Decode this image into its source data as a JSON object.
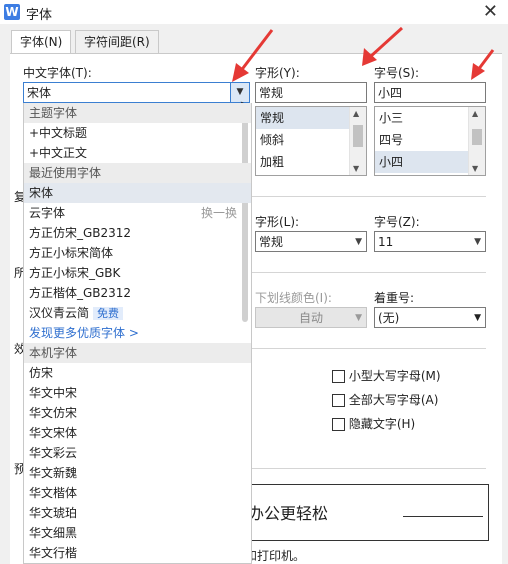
{
  "window": {
    "title": "字体",
    "app_icon_letter": "W"
  },
  "tabs": [
    {
      "label": "字体(N)",
      "active": true
    },
    {
      "label": "字符间距(R)",
      "active": false
    }
  ],
  "chinese_font": {
    "label": "中文字体(T):",
    "value": "宋体"
  },
  "style": {
    "label": "字形(Y):",
    "value": "常规",
    "options": [
      "常规",
      "倾斜",
      "加粗"
    ],
    "selected": "常规"
  },
  "size": {
    "label": "字号(S):",
    "value": "小四",
    "options": [
      "小三",
      "四号",
      "小四"
    ],
    "selected": "小四"
  },
  "latin_style": {
    "label": "字形(L):",
    "value": "常规"
  },
  "latin_size": {
    "label": "字号(Z):",
    "value": "11"
  },
  "underline_color": {
    "label": "下划线颜色(I):",
    "value": "自动",
    "disabled": true
  },
  "emphasis": {
    "label": "着重号:",
    "value": "(无)"
  },
  "effects": [
    {
      "label": "小型大写字母(M)",
      "checked": false
    },
    {
      "label": "全部大写字母(A)",
      "checked": false
    },
    {
      "label": "隐藏文字(H)",
      "checked": false
    }
  ],
  "preview": {
    "text": "办公更轻松",
    "note": "和打印机。"
  },
  "left_cutoff_letters": [
    "复",
    "所",
    "效",
    "预"
  ],
  "dropdown": {
    "items": [
      {
        "text": "主题字体",
        "kind": "header"
      },
      {
        "text": "+中文标题",
        "kind": "item"
      },
      {
        "text": "+中文正文",
        "kind": "item"
      },
      {
        "text": "最近使用字体",
        "kind": "header"
      },
      {
        "text": "宋体",
        "kind": "highlight"
      },
      {
        "text": "云字体",
        "kind": "item",
        "hint": "换一换"
      },
      {
        "text": "方正仿宋_GB2312",
        "kind": "item"
      },
      {
        "text": "方正小标宋简体",
        "kind": "item"
      },
      {
        "text": "方正小标宋_GBK",
        "kind": "item"
      },
      {
        "text": "方正楷体_GB2312",
        "kind": "item"
      },
      {
        "text": "汉仪青云简",
        "kind": "item",
        "tag": "免费"
      },
      {
        "text": "发现更多优质字体 >",
        "kind": "link"
      },
      {
        "text": "本机字体",
        "kind": "header"
      },
      {
        "text": "仿宋",
        "kind": "item"
      },
      {
        "text": "华文中宋",
        "kind": "item"
      },
      {
        "text": "华文仿宋",
        "kind": "item"
      },
      {
        "text": "华文宋体",
        "kind": "item"
      },
      {
        "text": "华文彩云",
        "kind": "item"
      },
      {
        "text": "华文新魏",
        "kind": "item"
      },
      {
        "text": "华文楷体",
        "kind": "item"
      },
      {
        "text": "华文琥珀",
        "kind": "item"
      },
      {
        "text": "华文细黑",
        "kind": "item"
      },
      {
        "text": "华文行楷",
        "kind": "item"
      }
    ]
  },
  "colors": {
    "annotation_arrow": "#e53935",
    "accent": "#3b7fd1",
    "link": "#2f6fcf"
  }
}
